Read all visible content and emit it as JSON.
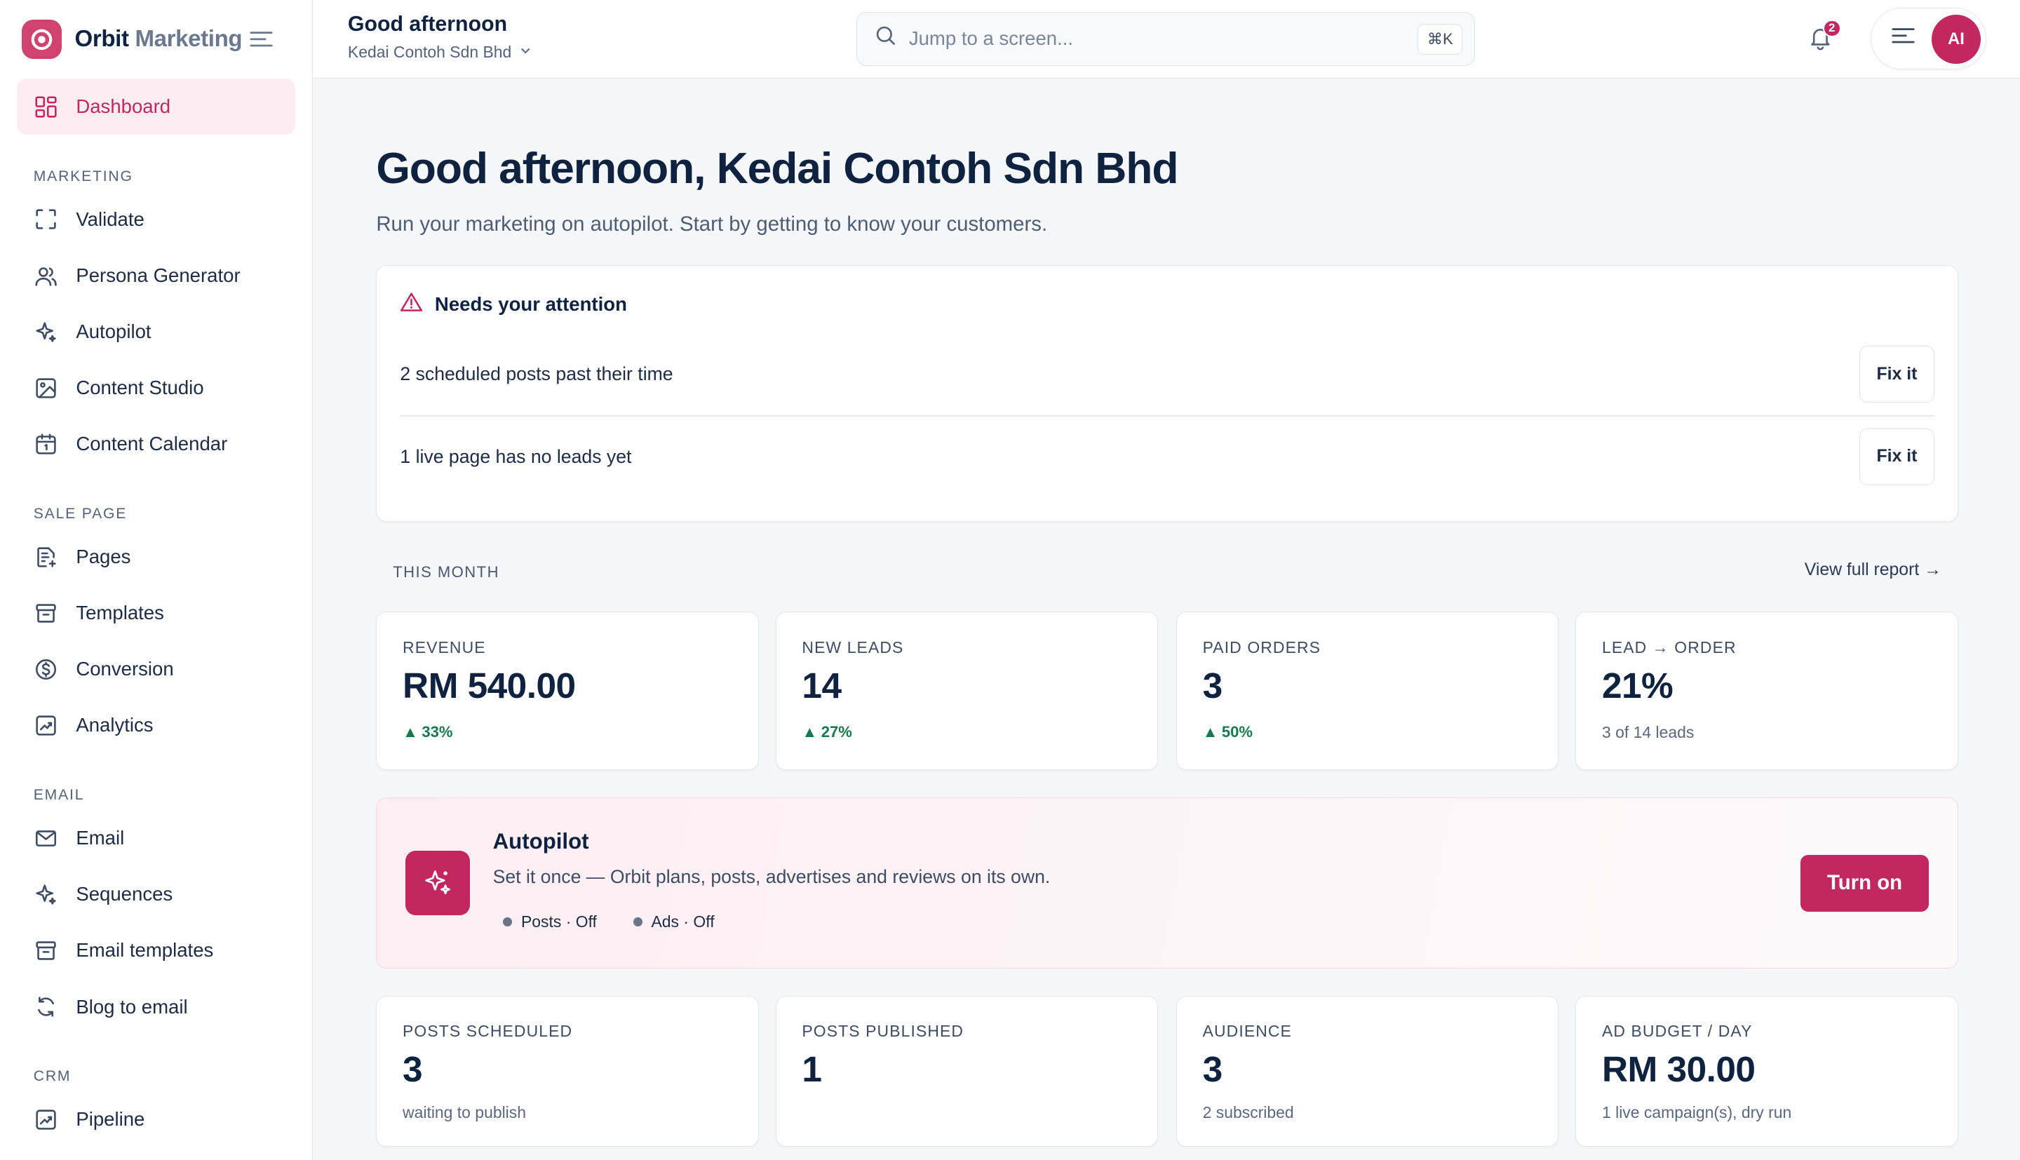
{
  "brand": {
    "name_main": "Orbit",
    "name_muted": "Marketing"
  },
  "sidebar": {
    "dashboard": "Dashboard",
    "sections": [
      {
        "title": "MARKETING",
        "items": [
          "Validate",
          "Persona Generator",
          "Autopilot",
          "Content Studio",
          "Content Calendar"
        ]
      },
      {
        "title": "SALE PAGE",
        "items": [
          "Pages",
          "Templates",
          "Conversion",
          "Analytics"
        ]
      },
      {
        "title": "EMAIL",
        "items": [
          "Email",
          "Sequences",
          "Email templates",
          "Blog to email"
        ]
      },
      {
        "title": "CRM",
        "items": [
          "Pipeline"
        ]
      }
    ],
    "icons": [
      "scan-icon",
      "users-icon",
      "sparkle-icon",
      "image-icon",
      "calendar-icon",
      "page-icon",
      "archive-icon",
      "dollar-icon",
      "chart-icon",
      "mail-icon",
      "sparkle-icon",
      "archive-icon",
      "refresh-icon",
      "chart-icon"
    ]
  },
  "topbar": {
    "title": "Good afternoon",
    "workspace": "Kedai Contoh Sdn Bhd",
    "search_placeholder": "Jump to a screen...",
    "shortcut": "⌘K",
    "notifications": "2",
    "avatar_initials": "AI"
  },
  "main": {
    "title": "Good afternoon, Kedai Contoh Sdn Bhd",
    "subtitle": "Run your marketing on autopilot. Start by getting to know your customers.",
    "attention": {
      "title": "Needs your attention",
      "items": [
        {
          "text": "2 scheduled posts past their time",
          "action": "Fix it"
        },
        {
          "text": "1 live page has no leads yet",
          "action": "Fix it"
        }
      ]
    },
    "period_label": "THIS MONTH",
    "report_link": "View full report →",
    "stats": [
      {
        "label": "REVENUE",
        "value": "RM 540.00",
        "delta": "33%"
      },
      {
        "label": "NEW LEADS",
        "value": "14",
        "delta": "27%"
      },
      {
        "label": "PAID ORDERS",
        "value": "3",
        "delta": "50%"
      },
      {
        "label": "LEAD → ORDER",
        "value": "21%",
        "note": "3 of 14 leads"
      }
    ],
    "autopilot": {
      "title": "Autopilot",
      "description": "Set it once — Orbit plans, posts, advertises and reviews on its own.",
      "posts_status": "Posts · Off",
      "ads_status": "Ads · Off",
      "button": "Turn on"
    },
    "stats2": [
      {
        "label": "POSTS SCHEDULED",
        "value": "3",
        "note": "waiting to publish"
      },
      {
        "label": "POSTS PUBLISHED",
        "value": "1",
        "note": ""
      },
      {
        "label": "AUDIENCE",
        "value": "3",
        "note": "2 subscribed"
      },
      {
        "label": "AD BUDGET / DAY",
        "value": "RM 30.00",
        "note": "1 live campaign(s), dry run"
      }
    ]
  },
  "colors": {
    "accent": "#c2285f",
    "positive": "#157a4c",
    "text": "#0f2340"
  }
}
